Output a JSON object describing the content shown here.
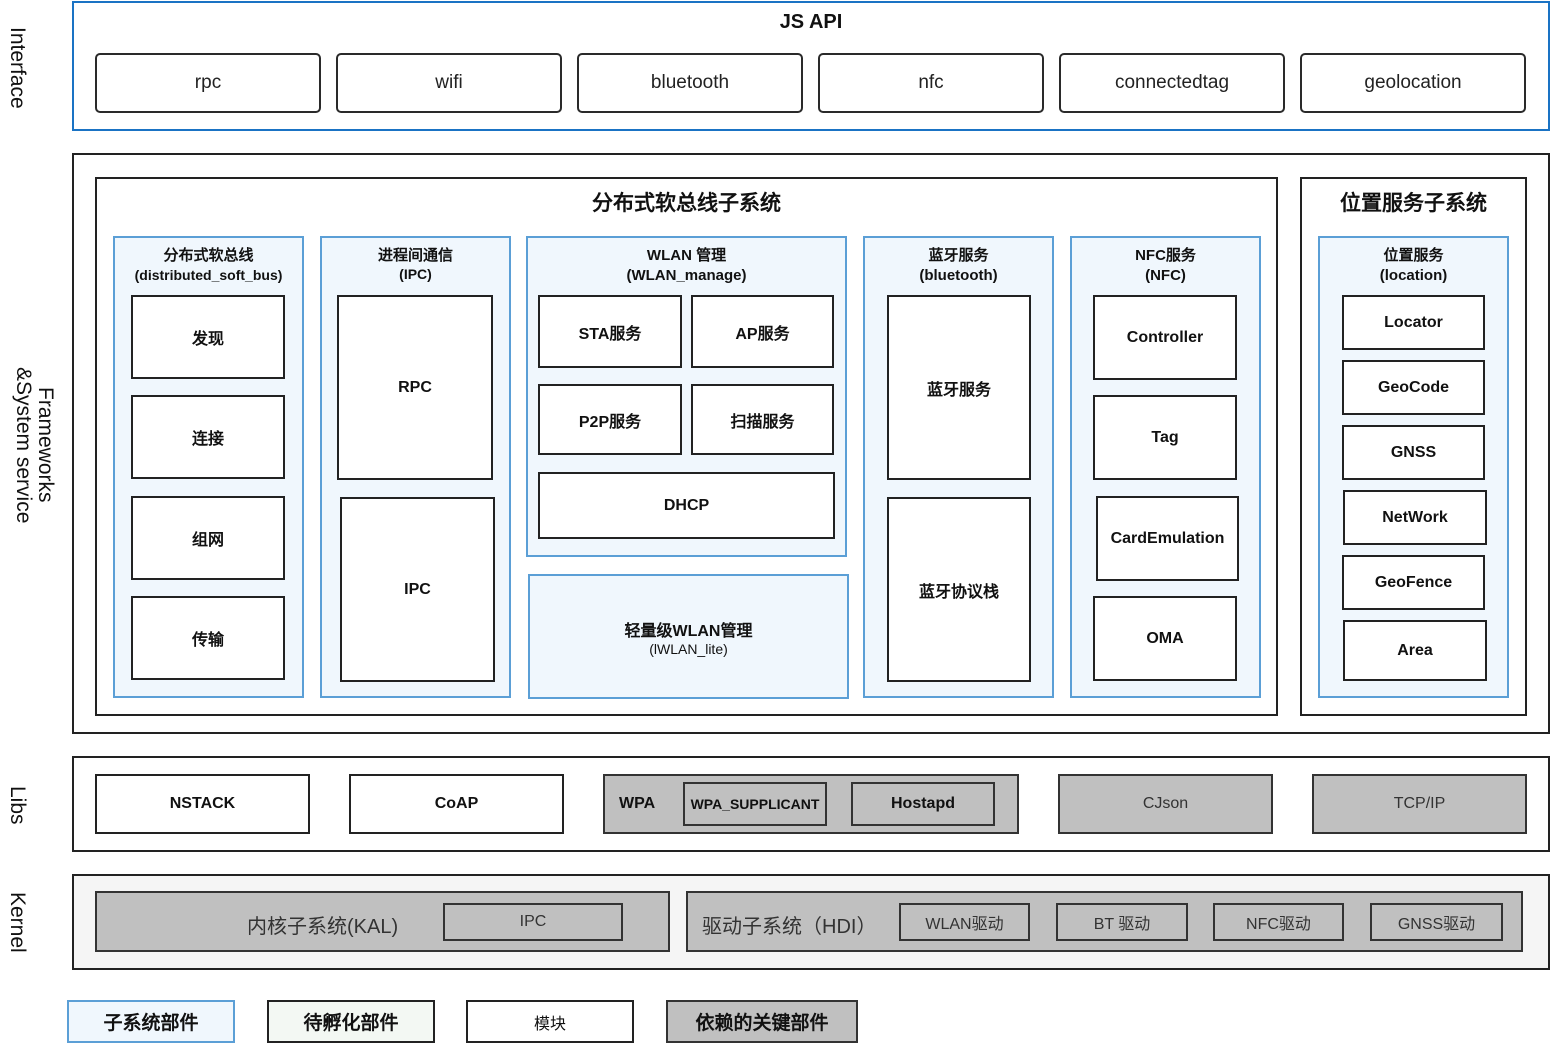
{
  "layers": {
    "interface": "Interface",
    "frameworks": "Frameworks\n&System service",
    "libs": "Libs",
    "kernel": "Kernel"
  },
  "interface": {
    "title": "JS API",
    "apis": [
      "rpc",
      "wifi",
      "bluetooth",
      "nfc",
      "connectedtag",
      "geolocation"
    ]
  },
  "frameworks": {
    "softbus_system": {
      "title": "分布式软总线子系统",
      "softbus": {
        "title": "分布式软总线",
        "subtitle": "(distributed_soft_bus)",
        "modules": [
          "发现",
          "连接",
          "组网",
          "传输"
        ]
      },
      "ipc": {
        "title": "进程间通信",
        "subtitle": "(IPC)",
        "modules": [
          "RPC",
          "IPC"
        ]
      },
      "wlan": {
        "title": "WLAN 管理",
        "subtitle": "(WLAN_manage)",
        "modules": [
          "STA服务",
          "AP服务",
          "P2P服务",
          "扫描服务",
          "DHCP"
        ]
      },
      "wlan_lite": {
        "title": "轻量级WLAN管理",
        "subtitle": "(lWLAN_lite)"
      },
      "bluetooth": {
        "title": "蓝牙服务",
        "subtitle": "(bluetooth)",
        "modules": [
          "蓝牙服务",
          "蓝牙协议栈"
        ]
      },
      "nfc": {
        "title": "NFC服务",
        "subtitle": "(NFC)",
        "modules": [
          "Controller",
          "Tag",
          "CardEmulation",
          "OMA"
        ]
      }
    },
    "location_system": {
      "title": "位置服务子系统",
      "location": {
        "title": "位置服务",
        "subtitle": "(location)",
        "modules": [
          "Locator",
          "GeoCode",
          "GNSS",
          "NetWork",
          "GeoFence",
          "Area"
        ]
      }
    }
  },
  "libs": {
    "nstack": "NSTACK",
    "coap": "CoAP",
    "wpa": {
      "label": "WPA",
      "supplicant": "WPA_SUPPLICANT",
      "hostapd": "Hostapd"
    },
    "cjson": "CJson",
    "tcpip": "TCP/IP"
  },
  "kernel": {
    "kal": {
      "label": "内核子系统(KAL)",
      "ipc": "IPC"
    },
    "hdi": {
      "label": "驱动子系统（HDI）",
      "drivers": [
        "WLAN驱动",
        "BT 驱动",
        "NFC驱动",
        "GNSS驱动"
      ]
    }
  },
  "legend": {
    "items": [
      "子系统部件",
      "待孵化部件",
      "模块",
      "依赖的关键部件"
    ]
  }
}
